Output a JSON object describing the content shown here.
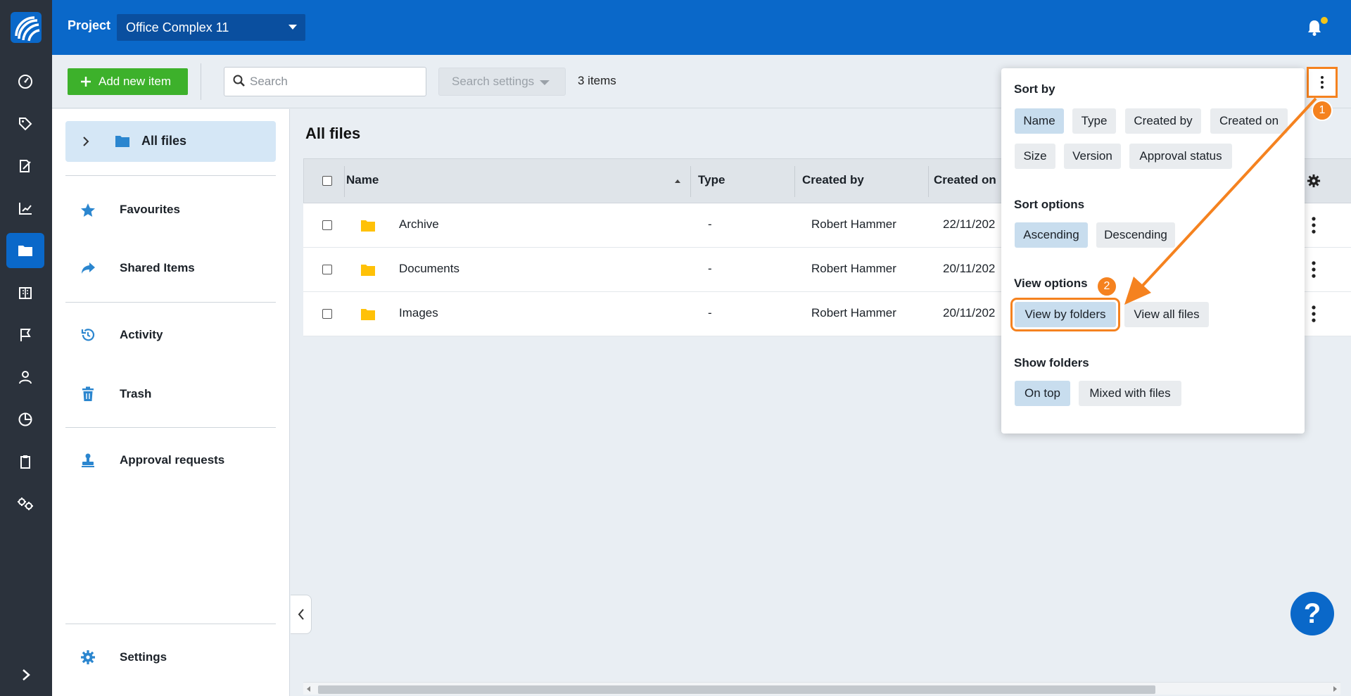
{
  "topbar": {
    "project_label": "Project",
    "project_name": "Office Complex 11"
  },
  "toolbar": {
    "add_label": "Add new item",
    "search_placeholder": "Search",
    "search_settings_label": "Search settings",
    "items_count": "3 items"
  },
  "sidebar": {
    "all_files_label": "All files",
    "items": [
      {
        "label": "Favourites",
        "icon": "star-icon"
      },
      {
        "label": "Shared Items",
        "icon": "share-icon"
      },
      {
        "label": "Activity",
        "icon": "history-icon"
      },
      {
        "label": "Trash",
        "icon": "trash-icon"
      },
      {
        "label": "Approval requests",
        "icon": "stamp-icon"
      },
      {
        "label": "Settings",
        "icon": "gear-icon"
      }
    ]
  },
  "main": {
    "title": "All files",
    "columns": [
      "Name",
      "Type",
      "Created by",
      "Created on"
    ],
    "rows": [
      {
        "name": "Archive",
        "type": "-",
        "created_by": "Robert Hammer",
        "created_on": "22/11/202"
      },
      {
        "name": "Documents",
        "type": "-",
        "created_by": "Robert Hammer",
        "created_on": "20/11/202"
      },
      {
        "name": "Images",
        "type": "-",
        "created_by": "Robert Hammer",
        "created_on": "20/11/202"
      }
    ]
  },
  "dropdown": {
    "sort_by_heading": "Sort by",
    "sort_by": [
      "Name",
      "Type",
      "Created by",
      "Created on",
      "Size",
      "Version",
      "Approval status"
    ],
    "sort_options_heading": "Sort options",
    "sort_options": [
      "Ascending",
      "Descending"
    ],
    "view_options_heading": "View options",
    "view_options": [
      "View by folders",
      "View all files"
    ],
    "show_folders_heading": "Show folders",
    "show_folders": [
      "On top",
      "Mixed with files"
    ]
  },
  "annotations": {
    "step1": "1",
    "step2": "2"
  },
  "help": {
    "label": "?"
  },
  "colors": {
    "brand_blue": "#0a68c9",
    "rail": "#2b323c",
    "add_green": "#3db12b",
    "annotation_orange": "#f5821f",
    "folder_yellow": "#ffc107",
    "chip_selected": "#c8ddee"
  }
}
